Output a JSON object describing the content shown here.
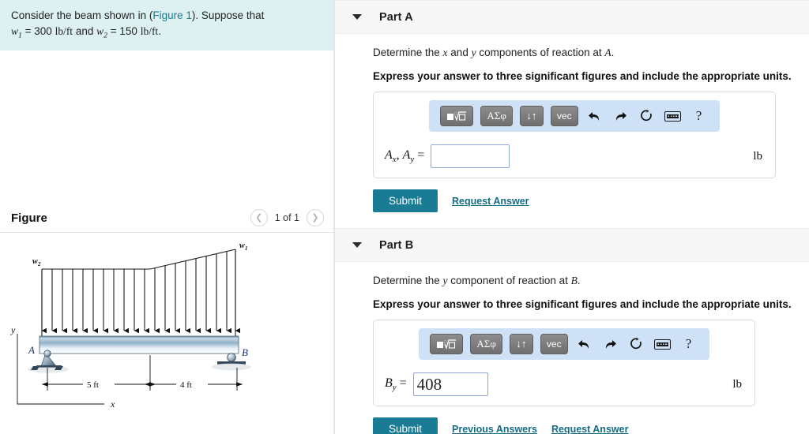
{
  "problem": {
    "line1_pre": "Consider the beam shown in (",
    "line1_link": "Figure 1",
    "line1_post": "). Suppose that",
    "w1_symbol": "w",
    "w1_sub": "1",
    "w1_value": "300",
    "w1_units": "lb/ft",
    "connector": "and",
    "w2_symbol": "w",
    "w2_sub": "2",
    "w2_value": "150",
    "w2_units": "lb/ft",
    "trailing": "."
  },
  "figure": {
    "title": "Figure",
    "counter": "1 of 1",
    "prev_icon": "chevron-left-icon",
    "next_icon": "chevron-right-icon",
    "labels": {
      "w1": "w",
      "w1_sub": "1",
      "w2": "w",
      "w2_sub": "2",
      "support_a": "A",
      "support_b": "B",
      "axis_y": "y",
      "axis_x": "x",
      "dim_left": "5 ft",
      "dim_right": "4 ft"
    }
  },
  "parts": [
    {
      "id": "part-a",
      "header": "Part A",
      "caret_icon": "caret-down-icon",
      "prompt_pre": "Determine the ",
      "prompt_x": "x",
      "prompt_mid": " and ",
      "prompt_y": "y",
      "prompt_post": " components of reaction at ",
      "prompt_target": "A",
      "prompt_end": ".",
      "instruction": "Express your answer to three significant figures and include the appropriate units.",
      "field_label_a": "A",
      "field_label_a_sub": "x",
      "field_label_comma": ", ",
      "field_label_b": "A",
      "field_label_b_sub": "y",
      "field_label_eq": " =",
      "input_value": "",
      "input_placeholder": "",
      "units": "lb",
      "submit_label": "Submit",
      "links": [
        "Request Answer"
      ]
    },
    {
      "id": "part-b",
      "header": "Part B",
      "caret_icon": "caret-down-icon",
      "prompt_pre": "Determine the ",
      "prompt_x": "",
      "prompt_mid": "",
      "prompt_y": "y",
      "prompt_post": " component of reaction at ",
      "prompt_target": "B",
      "prompt_end": ".",
      "instruction": "Express your answer to three significant figures and include the appropriate units.",
      "field_label_a": "B",
      "field_label_a_sub": "y",
      "field_label_comma": "",
      "field_label_b": "",
      "field_label_b_sub": "",
      "field_label_eq": " =",
      "input_value": "408",
      "input_placeholder": "",
      "units": "lb",
      "submit_label": "Submit",
      "links": [
        "Previous Answers",
        "Request Answer"
      ]
    }
  ],
  "mathbar": {
    "buttons": [
      {
        "name": "template-radical-button",
        "glyph": "▪√▫"
      },
      {
        "name": "greek-symbols-button",
        "glyph": "ΑΣφ"
      },
      {
        "name": "sort-arrows-button",
        "glyph": "↓↑"
      },
      {
        "name": "vector-button",
        "glyph": "vec"
      }
    ],
    "icons": [
      {
        "name": "undo-icon",
        "glyph": "↰"
      },
      {
        "name": "redo-icon",
        "glyph": "↱"
      },
      {
        "name": "reset-icon",
        "glyph": "↻"
      },
      {
        "name": "keyboard-icon",
        "glyph": "keyboard"
      },
      {
        "name": "help-icon",
        "glyph": "?"
      }
    ]
  },
  "colors": {
    "statement_bg": "#ddf1f2",
    "link": "#1a7b8c",
    "submit_bg": "#1a7b95",
    "mathbar_bg": "#cfe1f7",
    "part_header_bg": "#f7f7f7",
    "input_border": "#8ca7d8"
  }
}
